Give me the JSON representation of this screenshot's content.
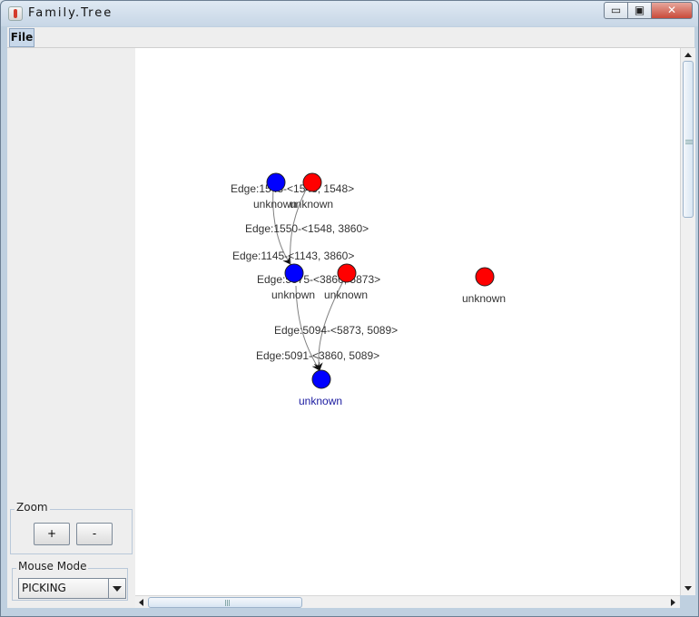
{
  "window": {
    "title": "Family.Tree",
    "min_glyph": "▭",
    "max_glyph": "▣",
    "close_glyph": "✕"
  },
  "menu": {
    "file": "File"
  },
  "zoom": {
    "label": "Zoom",
    "in": "+",
    "out": "-"
  },
  "mouse_mode": {
    "label": "Mouse Mode",
    "value": "PICKING"
  },
  "colors": {
    "male": "#0000ff",
    "female": "#ff0000",
    "edge": "#808080",
    "selected_label": "#1a1aa0"
  },
  "graph": {
    "nodes": [
      {
        "id": "n1",
        "gender": "male",
        "label": "unknown"
      },
      {
        "id": "n2",
        "gender": "female",
        "label": "unknown"
      },
      {
        "id": "n3",
        "gender": "male",
        "label": "unknown"
      },
      {
        "id": "n4",
        "gender": "female",
        "label": "unknown"
      },
      {
        "id": "n5",
        "gender": "female",
        "label": "unknown"
      },
      {
        "id": "n6",
        "gender": "male",
        "label": "unknown",
        "selected": true
      }
    ],
    "edges": [
      {
        "id": "e1",
        "label": "Edge:1548-<1548, 1548>"
      },
      {
        "id": "e2",
        "label": "Edge:1550-<1548, 3860>"
      },
      {
        "id": "e3",
        "label": "Edge:1145-<1143, 3860>"
      },
      {
        "id": "e4",
        "label": "Edge:5875-<3860, 5873>"
      },
      {
        "id": "e5",
        "label": "Edge:5094-<5873, 5089>"
      },
      {
        "id": "e6",
        "label": "Edge:5091-<3860, 5089>"
      }
    ]
  }
}
